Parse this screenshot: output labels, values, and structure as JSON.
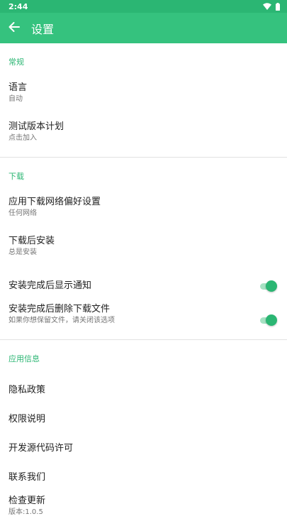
{
  "status_bar": {
    "time": "2:44",
    "icons": [
      "wifi-icon",
      "battery-icon"
    ]
  },
  "app_bar": {
    "back_icon": "arrow-left-icon",
    "title": "设置"
  },
  "sections": {
    "general": {
      "header": "常规",
      "language": {
        "title": "语言",
        "subtitle": "自动"
      },
      "beta": {
        "title": "测试版本计划",
        "subtitle": "点击加入"
      }
    },
    "download": {
      "header": "下载",
      "network": {
        "title": "应用下载网络偏好设置",
        "subtitle": "任何网络"
      },
      "install_after": {
        "title": "下载后安装",
        "subtitle": "总是安装"
      },
      "notify": {
        "title": "安装完成后显示通知",
        "enabled": true
      },
      "delete_file": {
        "title": "安装完成后删除下载文件",
        "subtitle": "如果你想保留文件，请关闭该选项",
        "enabled": true
      }
    },
    "app_info": {
      "header": "应用信息",
      "privacy": {
        "title": "隐私政策"
      },
      "permissions": {
        "title": "权限说明"
      },
      "open_source": {
        "title": "开发源代码许可"
      },
      "contact": {
        "title": "联系我们"
      },
      "update": {
        "title": "检查更新",
        "subtitle": "版本:1.0.5"
      }
    }
  },
  "colors": {
    "status_bar": "#2bb673",
    "app_bar": "#35c27e",
    "accent": "#2bb673",
    "switch_track": "#a6e2c3"
  }
}
